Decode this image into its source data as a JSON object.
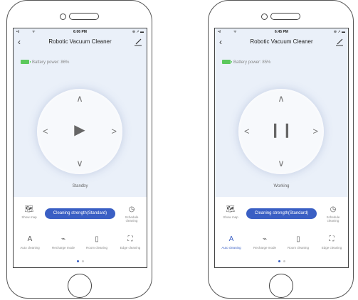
{
  "phones": [
    {
      "status_bar": {
        "signal": "•ıl",
        "wifi": "ᯤ",
        "time": "6:06 PM",
        "right": "⊕ ↗ ▬"
      },
      "title": "Robotic Vacuum Cleaner",
      "battery_text": "Battery power: 86%",
      "center_icon": "play-icon",
      "center_glyph": "▶",
      "state_text": "Standby",
      "show_map": "Show map",
      "strength_button": "Cleaning strength(Standard)",
      "schedule": "Schedule cleaning",
      "modes": [
        "Auto cleaning",
        "Recharge mode",
        "Room cleaning",
        "Edge cleaning"
      ],
      "active_mode": -1
    },
    {
      "status_bar": {
        "signal": "•ıl",
        "wifi": "ᯤ",
        "time": "6:45 PM",
        "right": "⊕ ↗ ▬"
      },
      "title": "Robotic Vacuum Cleaner",
      "battery_text": "Battery power: 85%",
      "center_icon": "pause-icon",
      "center_glyph": "❙❙",
      "state_text": "Working",
      "show_map": "Show map",
      "strength_button": "Cleaning strength(Standard)",
      "schedule": "Schedule cleaning",
      "modes": [
        "Auto cleaning",
        "Recharge mode",
        "Room cleaning",
        "Edge cleaning"
      ],
      "active_mode": 0
    }
  ],
  "colors": {
    "accent": "#3a5fc4",
    "battery": "#5cc85c",
    "screen_bg": "#eaf0f9"
  }
}
